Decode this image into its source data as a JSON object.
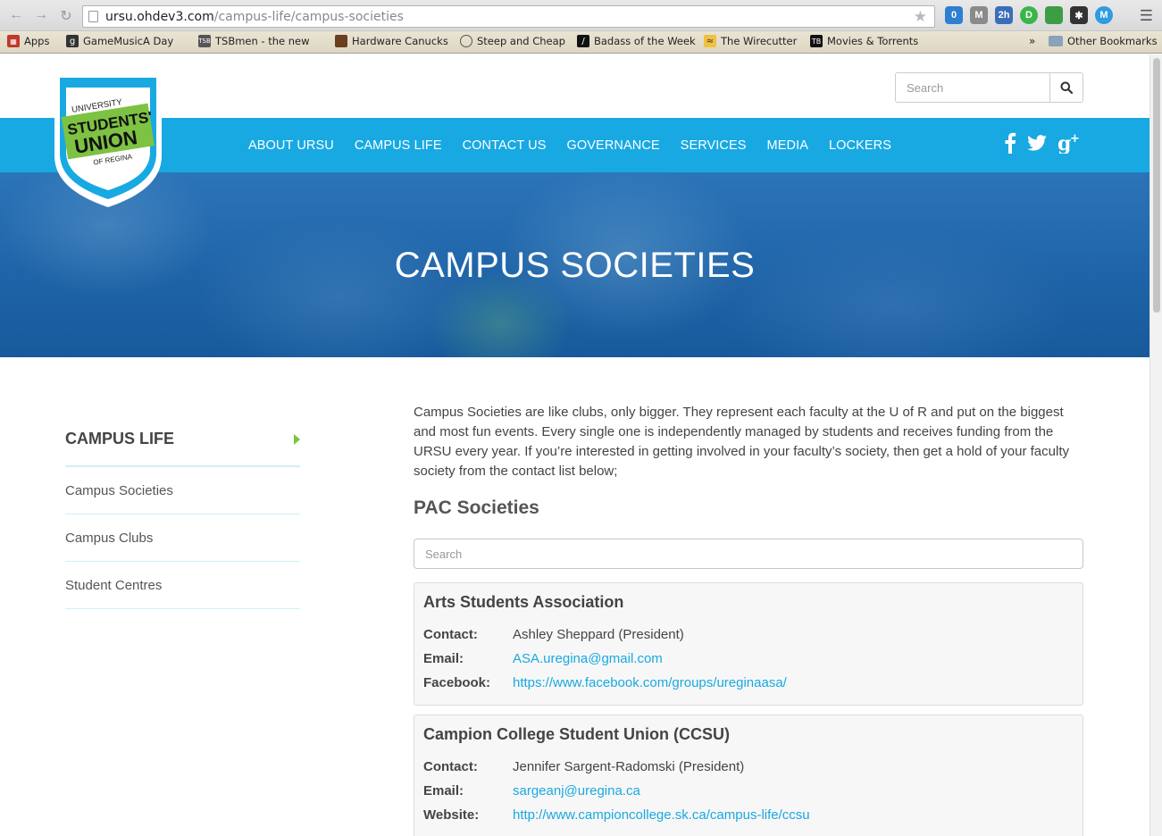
{
  "browser": {
    "url_domain": "ursu.ohdev3.com",
    "url_path": "/campus-life/campus-societies",
    "bookmarks": [
      {
        "label": "Apps"
      },
      {
        "label": "GameMusicA Day"
      },
      {
        "label": "TSBmen - the new"
      },
      {
        "label": "Hardware Canucks"
      },
      {
        "label": "Steep and Cheap"
      },
      {
        "label": "Badass of the Week"
      },
      {
        "label": "The Wirecutter"
      },
      {
        "label": "Movies & Torrents"
      }
    ],
    "overflow": "»",
    "other_bookmarks": "Other Bookmarks",
    "extensions": [
      {
        "text": "0",
        "color": "#2f7fd0"
      },
      {
        "text": "M",
        "color": "#8a8a8a"
      },
      {
        "text": "2h",
        "color": "#3a6fb8"
      },
      {
        "text": "D",
        "color": "#3bb54a"
      },
      {
        "text": "",
        "color": "#3c9d45"
      },
      {
        "text": "✱",
        "color": "#333333"
      },
      {
        "text": "M",
        "color": "#2f9be0"
      }
    ]
  },
  "site": {
    "logo": {
      "line1": "UNIVERSITY",
      "line2": "STUDENTS'",
      "line3": "UNION",
      "line4": "OF REGINA"
    },
    "search_placeholder": "Search",
    "nav": [
      "ABOUT URSU",
      "CAMPUS LIFE",
      "CONTACT US",
      "GOVERNANCE",
      "SERVICES",
      "MEDIA",
      "LOCKERS"
    ],
    "social": [
      "facebook-icon",
      "twitter-icon",
      "google-plus-icon"
    ],
    "hero_title": "CAMPUS SOCIETIES",
    "sidebar": {
      "heading": "CAMPUS LIFE",
      "items": [
        "Campus Societies",
        "Campus Clubs",
        "Student Centres"
      ]
    },
    "intro": "Campus Societies are like clubs, only bigger. They represent each faculty at the U of R and put on the biggest and most fun events. Every single one is independently managed by students and receives funding from the URSU every year. If you’re interested in getting involved in your faculty’s society, then get a hold of your faculty society from the contact list below;",
    "section_title": "PAC Societies",
    "society_search_placeholder": "Search",
    "societies": [
      {
        "name": "Arts Students Association",
        "contact_label": "Contact:",
        "contact": "Ashley Sheppard (President)",
        "email_label": "Email:",
        "email": "ASA.uregina@gmail.com",
        "link_label": "Facebook:",
        "link": "https://www.facebook.com/groups/ureginaasa/"
      },
      {
        "name": "Campion College Student Union (CCSU)",
        "contact_label": "Contact:",
        "contact": "Jennifer Sargent-Radomski (President)",
        "email_label": "Email:",
        "email": "sargeanj@uregina.ca",
        "link_label": "Website:",
        "link": "http://www.campioncollege.sk.ca/campus-life/ccsu"
      }
    ],
    "colors": {
      "nav_blue": "#18a9e2",
      "link": "#19a9e0",
      "accent_green": "#7dc242"
    }
  }
}
